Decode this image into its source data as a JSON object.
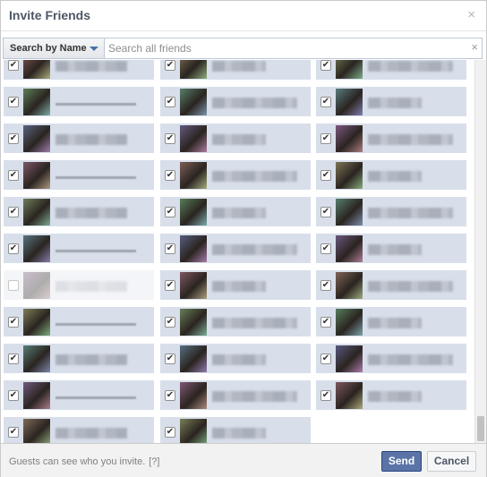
{
  "dialog": {
    "title": "Invite Friends",
    "close_glyph": "×"
  },
  "search": {
    "mode_label": "Search by Name",
    "placeholder": "Search all friends",
    "value": "",
    "clear_glyph": "×"
  },
  "grid": {
    "columns": 3,
    "tiles": [
      {
        "checked": true
      },
      {
        "checked": true
      },
      {
        "checked": true
      },
      {
        "checked": true
      },
      {
        "checked": true
      },
      {
        "checked": true
      },
      {
        "checked": true
      },
      {
        "checked": true
      },
      {
        "checked": true
      },
      {
        "checked": true
      },
      {
        "checked": true
      },
      {
        "checked": true
      },
      {
        "checked": true
      },
      {
        "checked": true
      },
      {
        "checked": true
      },
      {
        "checked": true
      },
      {
        "checked": true
      },
      {
        "checked": true
      },
      {
        "checked": false
      },
      {
        "checked": true
      },
      {
        "checked": true
      },
      {
        "checked": true
      },
      {
        "checked": true
      },
      {
        "checked": true
      },
      {
        "checked": true
      },
      {
        "checked": true
      },
      {
        "checked": true
      },
      {
        "checked": true
      },
      {
        "checked": true
      },
      {
        "checked": true
      },
      {
        "checked": true
      },
      {
        "checked": true
      }
    ]
  },
  "footer": {
    "note": "Guests can see who you invite.",
    "help_link": "[?]",
    "send_label": "Send",
    "cancel_label": "Cancel"
  },
  "colors": {
    "tile_selected": "#d8dfea",
    "send_button": "#5b74a8",
    "title_text": "#4e5665"
  }
}
